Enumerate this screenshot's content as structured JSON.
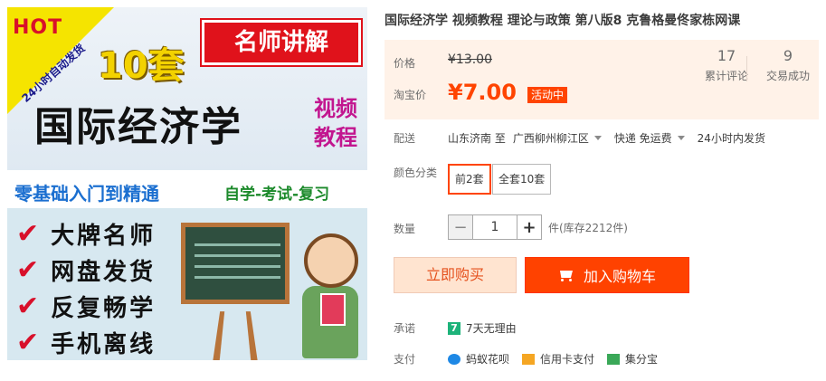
{
  "image": {
    "hot": "HOT",
    "hot_sub": "24小时自动发货",
    "count": "10套",
    "famous": "名师讲解",
    "main_title": "国际经济学",
    "video_tutorial": "视频教程",
    "banner_left": "零基础入门到精通",
    "banner_right": "自学-考试-复习",
    "features": [
      "大牌名师",
      "网盘发货",
      "反复畅学",
      "手机离线"
    ]
  },
  "product": {
    "title": "国际经济学 视频教程 理论与政策 第八版8 克鲁格曼佟家栋网课"
  },
  "price": {
    "label": "价格",
    "original": "¥13.00",
    "taobao_label": "淘宝价",
    "current": "¥7.00",
    "promo_badge": "活动中",
    "reviews_count": "17",
    "reviews_label": "累计评论",
    "sales_count": "9",
    "sales_label": "交易成功"
  },
  "shipping": {
    "label": "配送",
    "from": "山东济南 至",
    "to": "广西柳州柳江区",
    "method": "快递 免运费",
    "dispatch": "24小时内发货"
  },
  "sku": {
    "label": "颜色分类",
    "options": [
      "前2套",
      "全套10套"
    ],
    "selected_index": 0
  },
  "quantity": {
    "label": "数量",
    "value": "1",
    "stock": "件(库存2212件)"
  },
  "actions": {
    "buy_now": "立即购买",
    "add_to_cart": "加入购物车"
  },
  "promise": {
    "label": "承诺",
    "icon_text": "7",
    "text": "7天无理由"
  },
  "payment": {
    "label": "支付",
    "methods": [
      "蚂蚁花呗",
      "信用卡支付",
      "集分宝"
    ]
  },
  "colors": {
    "accent": "#ff4400",
    "price_bg": "#fff2e8"
  }
}
